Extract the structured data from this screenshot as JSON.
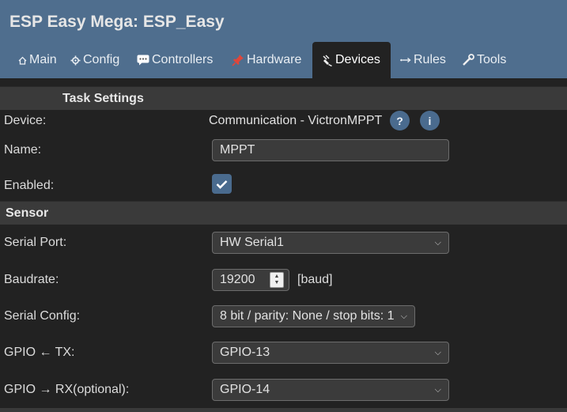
{
  "app": {
    "title": "ESP Easy Mega: ESP_Easy"
  },
  "tabs": [
    {
      "label": "Main",
      "icon": "home-icon"
    },
    {
      "label": "Config",
      "icon": "gear-icon"
    },
    {
      "label": "Controllers",
      "icon": "chat-icon"
    },
    {
      "label": "Hardware",
      "icon": "pin-icon"
    },
    {
      "label": "Devices",
      "icon": "plug-icon",
      "active": true
    },
    {
      "label": "Rules",
      "icon": "arrow-icon"
    },
    {
      "label": "Tools",
      "icon": "wrench-icon"
    }
  ],
  "task_settings": {
    "header": "Task Settings",
    "device_label": "Device:",
    "device_value": "Communication - VictronMPPT",
    "help_label": "?",
    "info_label": "i",
    "name_label": "Name:",
    "name_value": "MPPT",
    "enabled_label": "Enabled:",
    "enabled": true
  },
  "sensor": {
    "header": "Sensor",
    "serial_port_label": "Serial Port:",
    "serial_port_value": "HW Serial1",
    "baudrate_label": "Baudrate:",
    "baudrate_value": "19200",
    "baudrate_unit": "[baud]",
    "serial_config_label": "Serial Config:",
    "serial_config_value": "8 bit / parity: None / stop bits: 1",
    "gpio_tx_label": "GPIO ← TX:",
    "gpio_tx_value": "GPIO-13",
    "gpio_rx_label": "GPIO → RX(optional):",
    "gpio_rx_value": "GPIO-14"
  },
  "colors": {
    "header_bg": "#4f6e8e",
    "page_bg": "#222222",
    "section_bg": "#3a3a3a",
    "accent": "#4a6b8e"
  }
}
